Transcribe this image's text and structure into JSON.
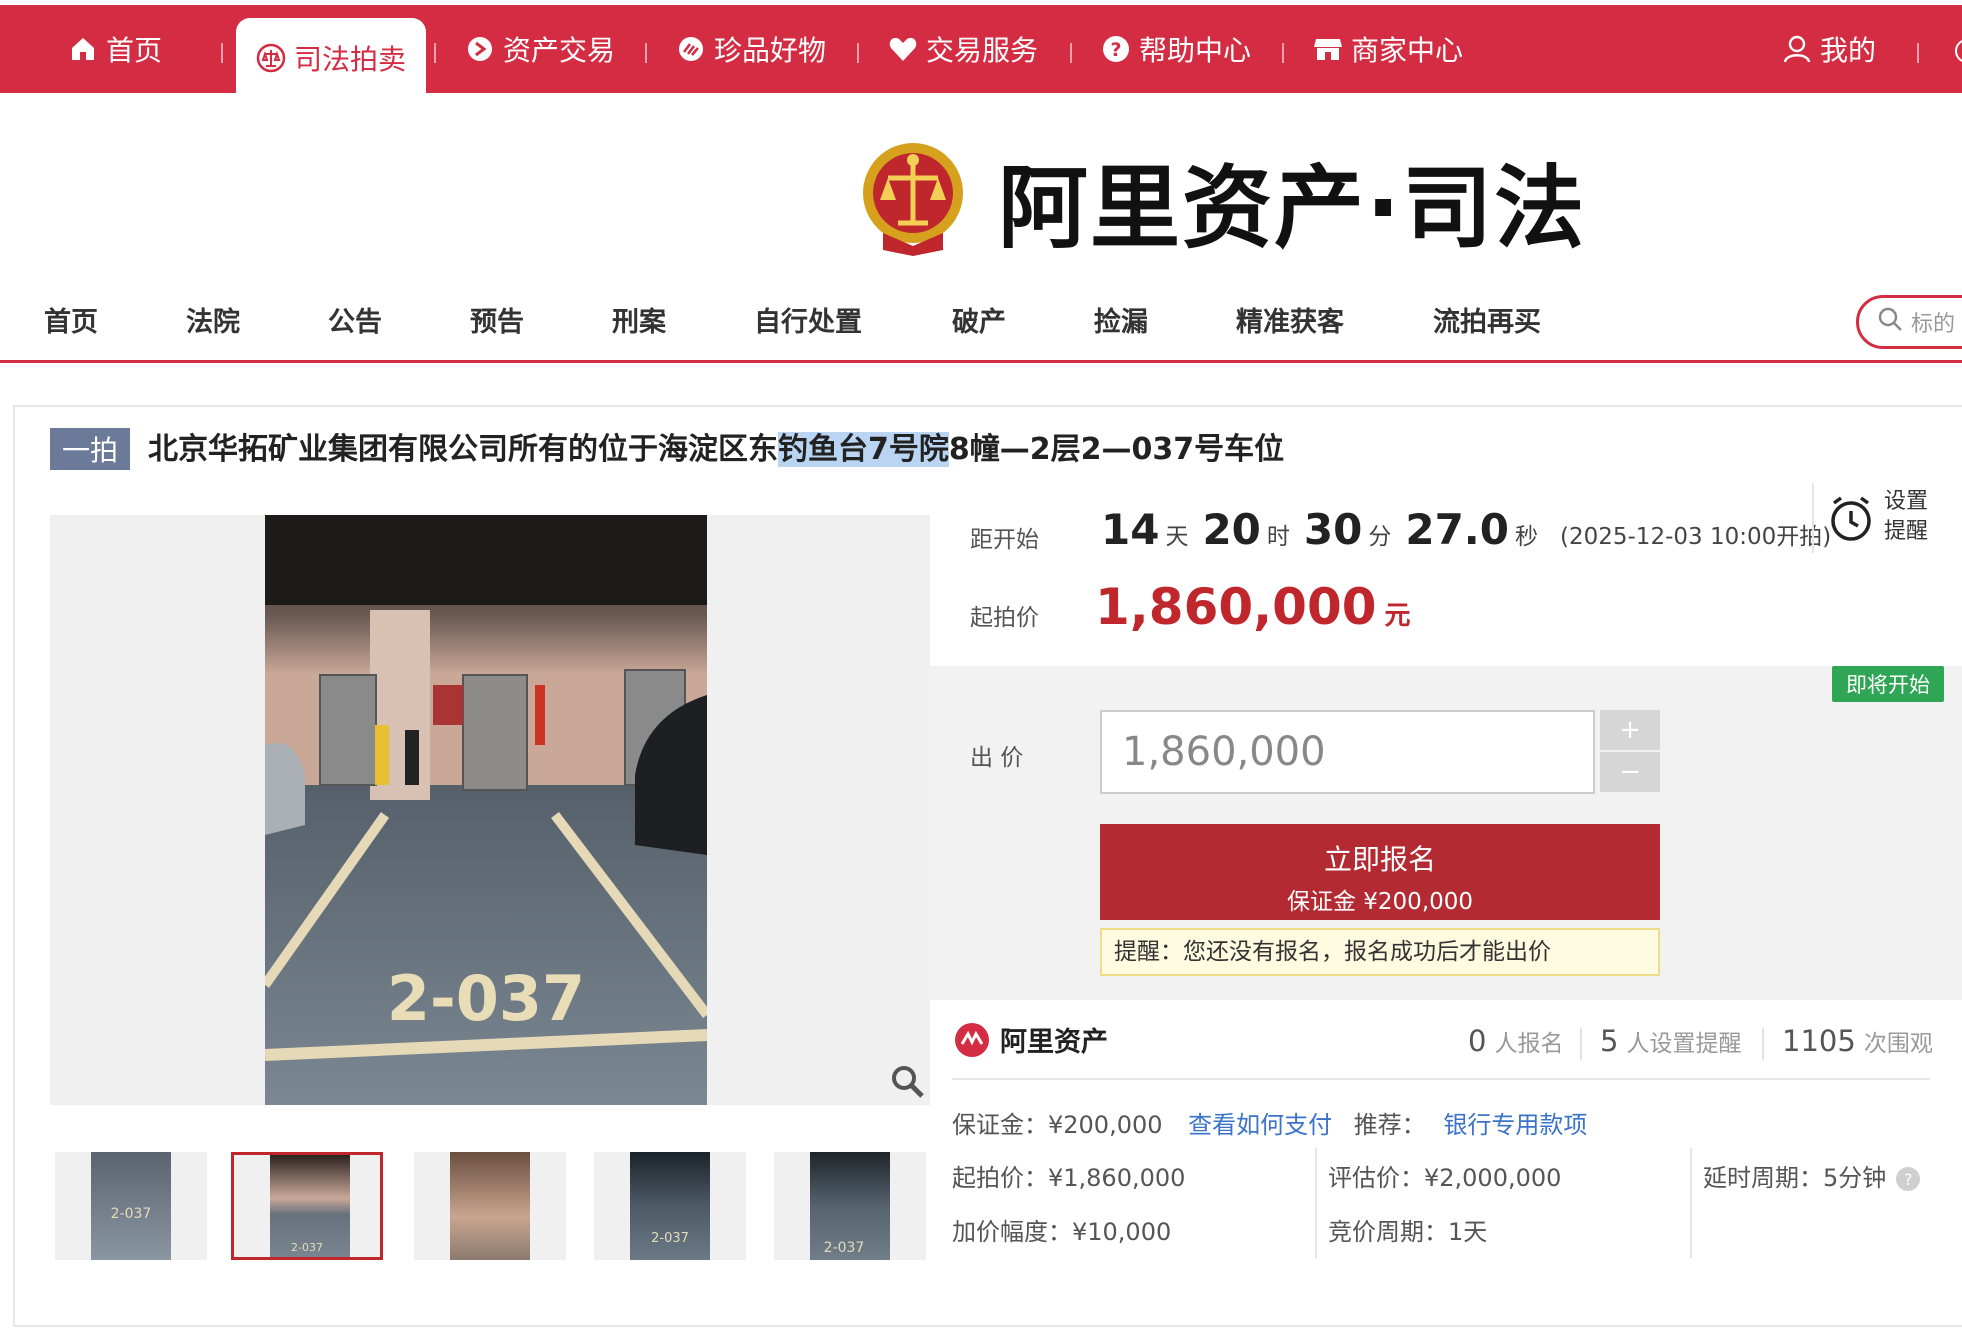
{
  "topnav": {
    "items": [
      {
        "label": "首页",
        "icon": "home-icon"
      },
      {
        "label": "司法拍卖",
        "icon": "court-emblem-icon"
      },
      {
        "label": "资产交易",
        "icon": "asset-icon"
      },
      {
        "label": "珍品好物",
        "icon": "treasure-icon"
      },
      {
        "label": "交易服务",
        "icon": "heart-icon"
      },
      {
        "label": "帮助中心",
        "icon": "help-icon"
      },
      {
        "label": "商家中心",
        "icon": "store-icon"
      }
    ],
    "mine": "我的",
    "active_index": 1
  },
  "brand": {
    "title": "阿里资产·司法"
  },
  "subnav": {
    "items": [
      "首页",
      "法院",
      "公告",
      "预告",
      "刑案",
      "自行处置",
      "破产",
      "捡漏",
      "精准获客",
      "流拍再买"
    ],
    "search_placeholder": "标的"
  },
  "item": {
    "round": "一拍",
    "title_pre": "北京华拓矿业集团有限公司所有的位于海淀区东",
    "title_hl": "钓鱼台7号院",
    "title_post": "8幢—2层2—037号车位",
    "photo_label": "2-037"
  },
  "countdown": {
    "label": "距开始",
    "days": "14",
    "days_unit": "天",
    "hours": "20",
    "hours_unit": "时",
    "minutes": "30",
    "minutes_unit": "分",
    "seconds": "27.0",
    "seconds_unit": "秒",
    "start_text": "(2025-12-03 10:00开拍)"
  },
  "reminder": {
    "line1": "设置",
    "line2": "提醒"
  },
  "price": {
    "label": "起拍价",
    "value": "1,860,000",
    "unit": "元"
  },
  "bid": {
    "status_tag": "即将开始",
    "label": "出 价",
    "input_value": "1,860,000",
    "plus": "+",
    "minus": "−",
    "signup_label": "立即报名",
    "deposit_text": "保证金 ¥200,000",
    "notice": "提醒：您还没有报名，报名成功后才能出价"
  },
  "stats": {
    "brand": "阿里资产",
    "signups": "0",
    "signups_label": "人报名",
    "reminders": "5",
    "reminders_label": "人设置提醒",
    "views": "1105",
    "views_label": "次围观"
  },
  "details": {
    "deposit": "保证金：¥200,000",
    "how_to_pay": "查看如何支付",
    "recommend_label": "推荐：",
    "recommend_link": "银行专用款项",
    "start_price": "起拍价：¥1,860,000",
    "appraisal": "评估价：¥2,000,000",
    "delay": "延时周期：5分钟",
    "increment": "加价幅度：¥10,000",
    "bid_period": "竞价周期：1天"
  },
  "colors": {
    "brand_red": "#d42d43",
    "price_red": "#c0272d",
    "button_red": "#b42a33",
    "tag_green": "#2fa655",
    "link_blue": "#3a73c9"
  }
}
